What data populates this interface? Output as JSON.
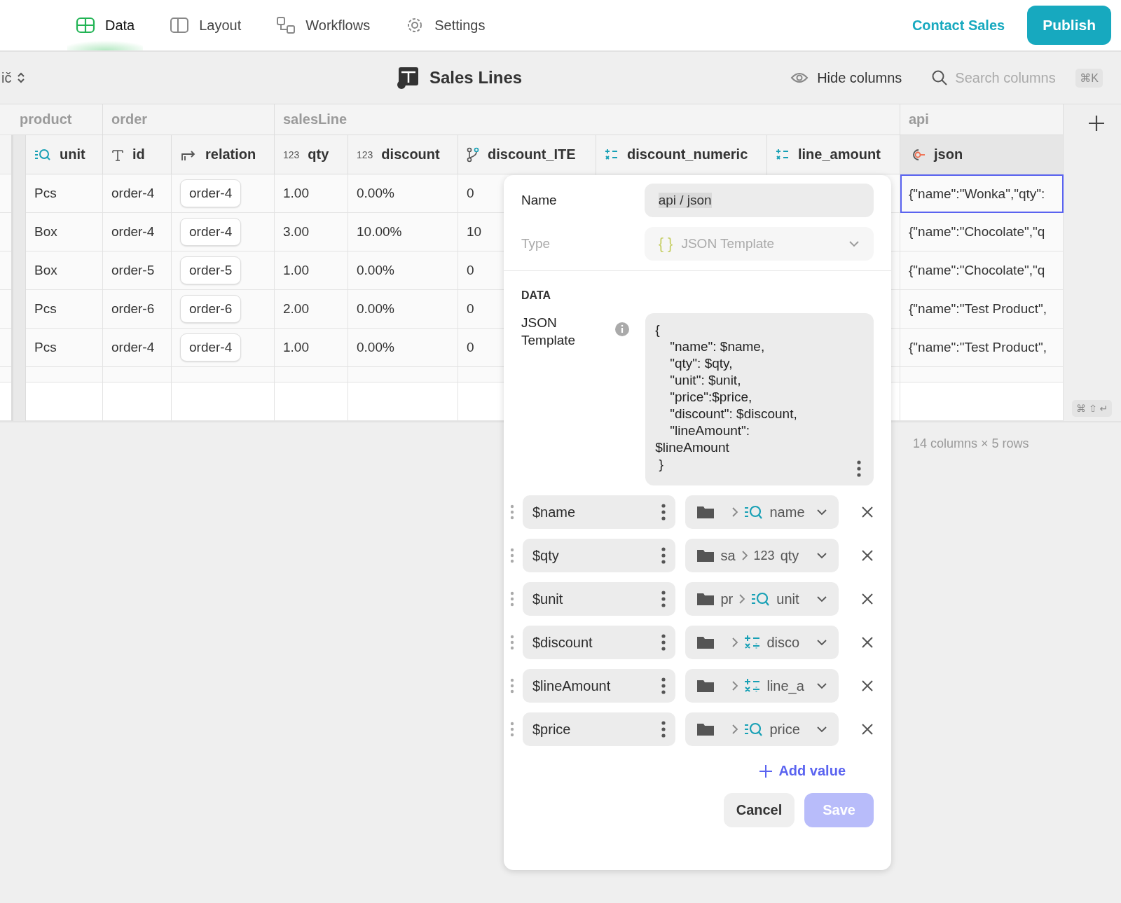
{
  "nav": {
    "tabs": [
      {
        "label": "Data",
        "kind": "grid",
        "selected": true
      },
      {
        "label": "Layout",
        "kind": "layout",
        "selected": false
      },
      {
        "label": "Workflows",
        "kind": "workflow",
        "selected": false
      },
      {
        "label": "Settings",
        "kind": "gear",
        "selected": false
      }
    ],
    "contact": "Contact Sales",
    "publish": "Publish"
  },
  "toolbar": {
    "left_label": "ič",
    "title": "Sales Lines",
    "hide_columns": "Hide columns",
    "search": {
      "placeholder": "Search columns"
    },
    "shortcut": "⌘K"
  },
  "table": {
    "groups": [
      {
        "label": "product"
      },
      {
        "label": "order"
      },
      {
        "label": "salesLine"
      },
      {
        "label": "api"
      }
    ],
    "columns": [
      {
        "label": "unit",
        "kind": "lookup"
      },
      {
        "label": "id",
        "kind": "text"
      },
      {
        "label": "relation",
        "kind": "relation"
      },
      {
        "label": "qty",
        "kind": "number",
        "type_label": "123"
      },
      {
        "label": "discount",
        "kind": "number",
        "type_label": "123"
      },
      {
        "label": "discount_ITE",
        "kind": "branch"
      },
      {
        "label": "discount_numeric",
        "kind": "math"
      },
      {
        "label": "line_amount",
        "kind": "math"
      },
      {
        "label": "json",
        "kind": "json"
      }
    ],
    "rows": [
      {
        "unit": "Pcs",
        "id": "order-4",
        "relation": "order-4",
        "qty": "1.00",
        "discount": "0.00%",
        "discount_ITE": "0",
        "json": "{\"name\":\"Wonka\",\"qty\":",
        "focused": true
      },
      {
        "unit": "Box",
        "id": "order-4",
        "relation": "order-4",
        "qty": "3.00",
        "discount": "10.00%",
        "discount_ITE": "10",
        "json": "{\"name\":\"Chocolate\",\"q",
        "focused": false
      },
      {
        "unit": "Box",
        "id": "order-5",
        "relation": "order-5",
        "qty": "1.00",
        "discount": "0.00%",
        "discount_ITE": "0",
        "json": "{\"name\":\"Chocolate\",\"q",
        "focused": false
      },
      {
        "unit": "Pcs",
        "id": "order-6",
        "relation": "order-6",
        "qty": "2.00",
        "discount": "0.00%",
        "discount_ITE": "0",
        "json": "{\"name\":\"Test Product\",",
        "focused": false
      },
      {
        "unit": "Pcs",
        "id": "order-4",
        "relation": "order-4",
        "qty": "1.00",
        "discount": "0.00%",
        "discount_ITE": "0",
        "json": "{\"name\":\"Test Product\",",
        "focused": false
      }
    ],
    "shortcut": "⌘ ⇧ ↵",
    "summary": "14 columns × 5 rows"
  },
  "editor": {
    "name_label": "Name",
    "name_value": "api / json",
    "type_label": "Type",
    "type_icon": "{ }",
    "type_value": "JSON Template",
    "type_disabled": true,
    "section": "DATA",
    "template_label": "JSON Template",
    "template": "{\n\t\"name\": $name,\n\t\"qty\": $qty,\n\t\"unit\": $unit,\n\t\"price\":$price,\n\t\"discount\": $discount,\n\t\"lineAmount\":\n$lineAmount\n }",
    "values": [
      {
        "variable": "$name",
        "kind": "lookup",
        "field": "name"
      },
      {
        "variable": "$qty",
        "prefix": "sa",
        "kind": "number",
        "type_label": "123",
        "field": "qty"
      },
      {
        "variable": "$unit",
        "prefix": "pr",
        "kind": "lookup",
        "field": "unit"
      },
      {
        "variable": "$discount",
        "kind": "math",
        "field": "disco"
      },
      {
        "variable": "$lineAmount",
        "kind": "math",
        "field": "line_a"
      },
      {
        "variable": "$price",
        "kind": "lookup",
        "field": "price"
      }
    ],
    "add_value": "Add value",
    "cancel": "Cancel",
    "save": "Save",
    "save_disabled": true
  }
}
